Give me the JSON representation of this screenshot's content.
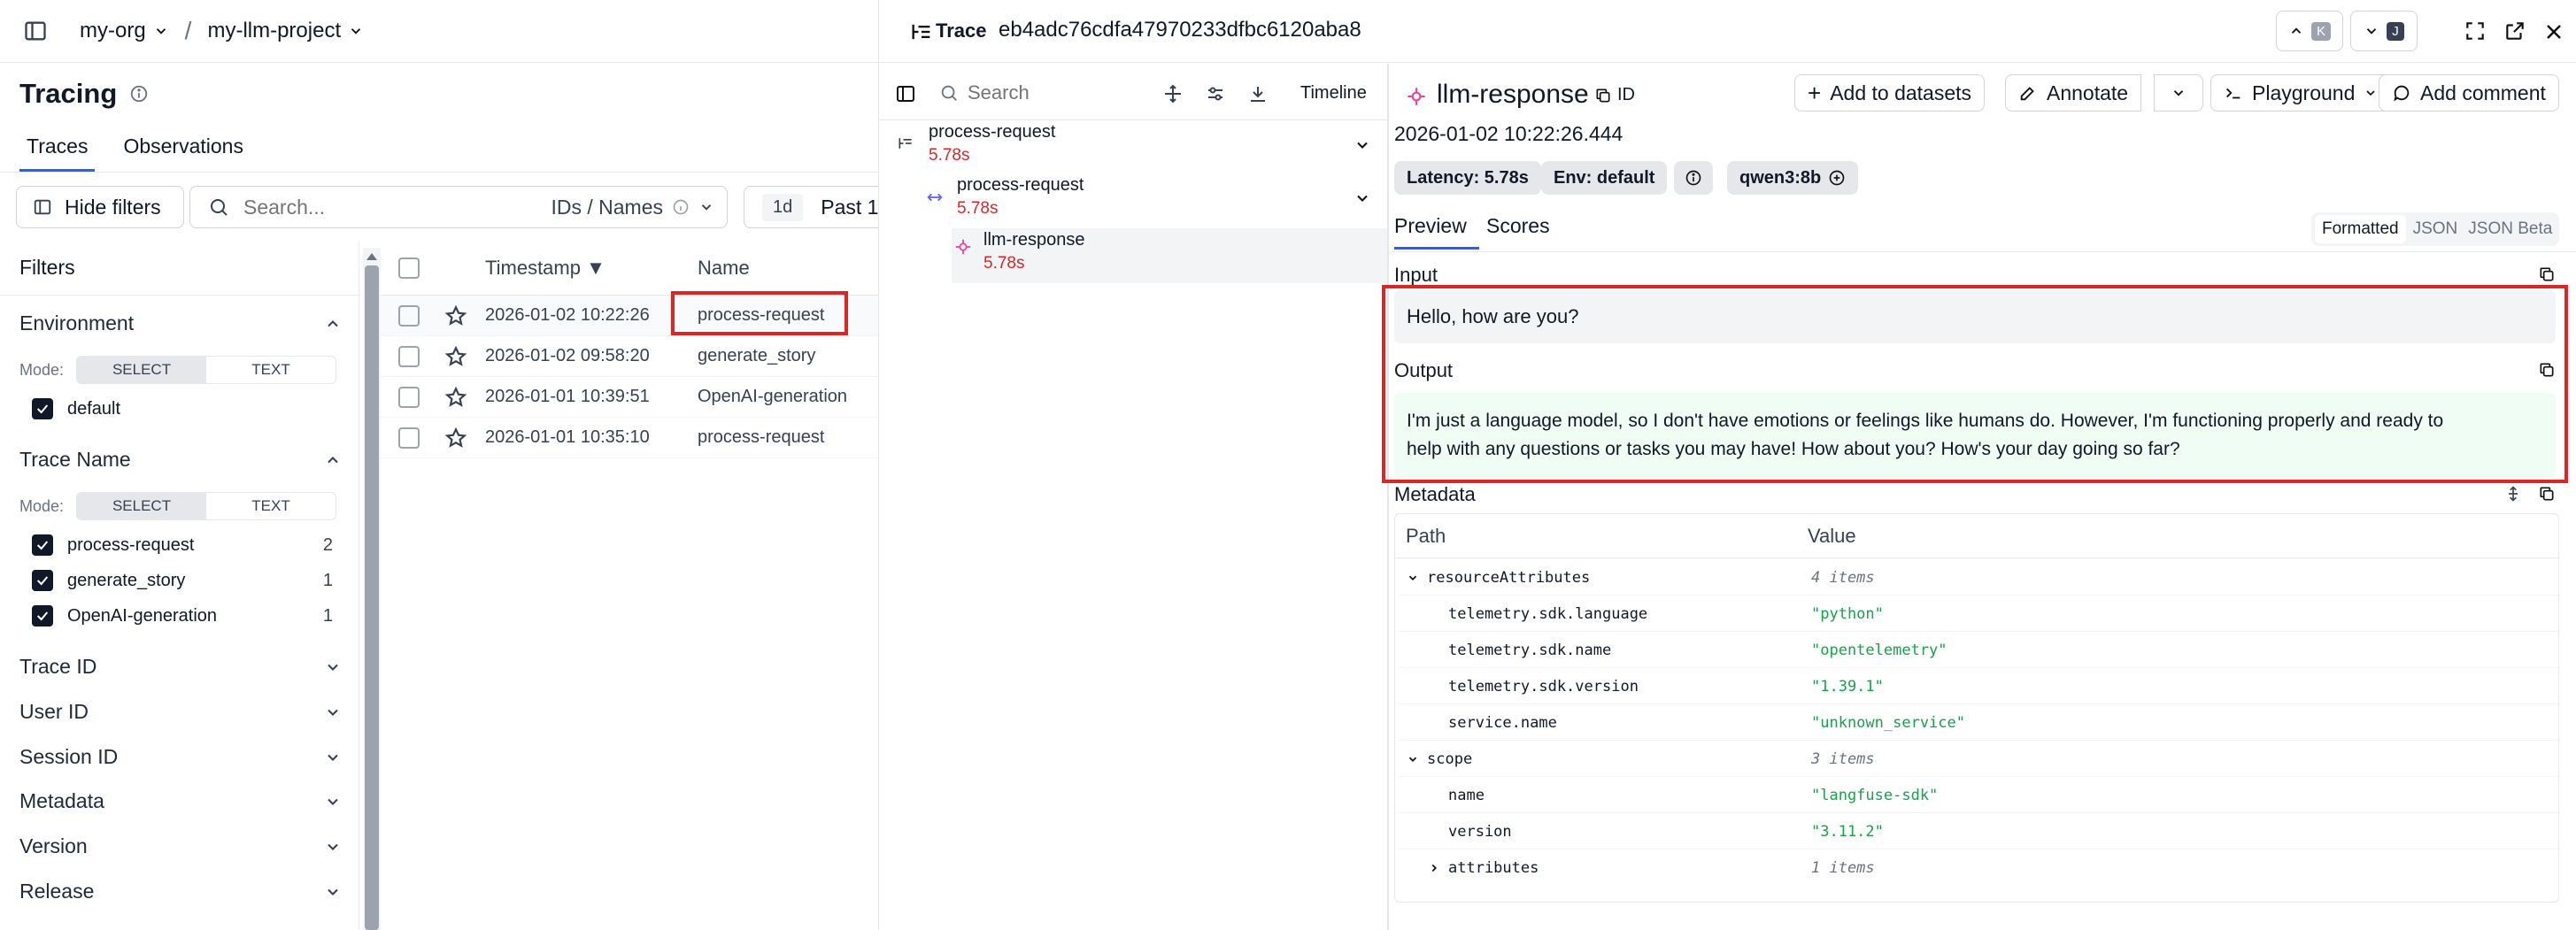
{
  "breadcrumb": {
    "org": "my-org",
    "separator": "/",
    "project": "my-llm-project"
  },
  "page": {
    "title": "Tracing"
  },
  "tabs": [
    {
      "label": "Traces"
    },
    {
      "label": "Observations"
    }
  ],
  "toolbar": {
    "hide_filters_label": "Hide filters",
    "search_placeholder": "Search...",
    "search_mode": "IDs / Names",
    "time_badge": "1d",
    "time_range": "Past 1"
  },
  "filters": {
    "heading": "Filters",
    "environment": {
      "label": "Environment",
      "mode_label": "Mode:",
      "mode_select": "SELECT",
      "mode_text": "TEXT",
      "options": [
        {
          "label": "default"
        }
      ]
    },
    "trace_name": {
      "label": "Trace Name",
      "mode_label": "Mode:",
      "mode_select": "SELECT",
      "mode_text": "TEXT",
      "options": [
        {
          "label": "process-request",
          "count": "2"
        },
        {
          "label": "generate_story",
          "count": "1"
        },
        {
          "label": "OpenAI-generation",
          "count": "1"
        }
      ]
    },
    "collapsed": [
      "Trace ID",
      "User ID",
      "Session ID",
      "Metadata",
      "Version",
      "Release"
    ]
  },
  "table": {
    "columns": {
      "timestamp": "Timestamp ▼",
      "name": "Name"
    },
    "rows": [
      {
        "timestamp": "2026-01-02 10:22:26",
        "name": "process-request"
      },
      {
        "timestamp": "2026-01-02 09:58:20",
        "name": "generate_story"
      },
      {
        "timestamp": "2026-01-01 10:39:51",
        "name": "OpenAI-generation"
      },
      {
        "timestamp": "2026-01-01 10:35:10",
        "name": "process-request"
      }
    ]
  },
  "trace": {
    "label": "Trace",
    "id": "eb4adc76cdfa47970233dfbc6120aba8",
    "nav_up_key": "K",
    "nav_down_key": "J",
    "tree": {
      "search_placeholder": "Search",
      "timeline_label": "Timeline",
      "nodes": [
        {
          "name": "process-request",
          "latency": "5.78s"
        },
        {
          "name": "process-request",
          "latency": "5.78s"
        },
        {
          "name": "llm-response",
          "latency": "5.78s"
        }
      ]
    },
    "detail": {
      "name": "llm-response",
      "id_label": "ID",
      "add_to_datasets": "Add to datasets",
      "annotate": "Annotate",
      "playground": "Playground",
      "add_comment": "Add comment",
      "timestamp": "2026-01-02 10:22:26.444",
      "latency_pill": "Latency: 5.78s",
      "env_pill": "Env: default",
      "model_pill": "qwen3:8b",
      "tabs": {
        "preview": "Preview",
        "scores": "Scores"
      },
      "view_modes": {
        "formatted": "Formatted",
        "json": "JSON",
        "json_beta": "JSON Beta"
      },
      "input_label": "Input",
      "input_text": "Hello, how are you?",
      "output_label": "Output",
      "output_line1": "I'm just a language model, so I don't have emotions or feelings like humans do. However, I'm functioning properly and ready to",
      "output_line2": "help with any questions or tasks you may have! How about you? How's your day going so far?",
      "metadata_label": "Metadata",
      "metadata_columns": {
        "path": "Path",
        "value": "Value"
      },
      "metadata_rows": [
        {
          "key": "resourceAttributes",
          "value": "4 items",
          "kind": "group"
        },
        {
          "key": "telemetry.sdk.language",
          "value": "\"python\"",
          "kind": "leaf"
        },
        {
          "key": "telemetry.sdk.name",
          "value": "\"opentelemetry\"",
          "kind": "leaf"
        },
        {
          "key": "telemetry.sdk.version",
          "value": "\"1.39.1\"",
          "kind": "leaf"
        },
        {
          "key": "service.name",
          "value": "\"unknown_service\"",
          "kind": "leaf"
        },
        {
          "key": "scope",
          "value": "3 items",
          "kind": "group"
        },
        {
          "key": "name",
          "value": "\"langfuse-sdk\"",
          "kind": "leaf"
        },
        {
          "key": "version",
          "value": "\"3.11.2\"",
          "kind": "leaf"
        },
        {
          "key": "attributes",
          "value": "1 items",
          "kind": "collapsed"
        }
      ]
    }
  },
  "colors": {
    "accent": "#2563eb",
    "highlight_box": "#dc2626",
    "latency": "#dc2626",
    "json_string": "#16a34a",
    "output_bg": "#f0fdf4",
    "input_bg": "#f3f4f6"
  }
}
